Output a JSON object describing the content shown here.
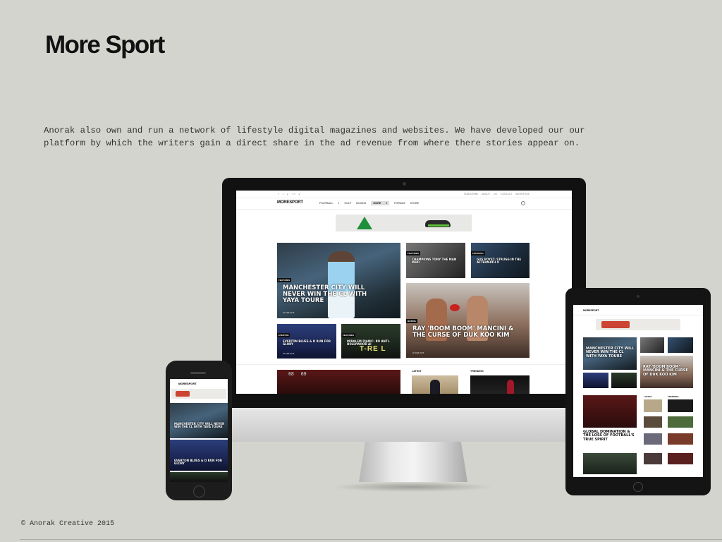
{
  "page": {
    "title": "More Sport",
    "intro": "Anorak also own and run a network of lifestyle digital magazines and websites. We have developed our our platform by which the writers gain a direct share in the ad revenue from where there stories appear on.",
    "footer": "© Anorak Creative 2015"
  },
  "site": {
    "logo": "MORESPORT",
    "social": "f t p in y",
    "top_links": "SUBSCRIBE ABOUT US CONTACT ADVERTISE",
    "nav": [
      "FOOTBALL ▾",
      "GOLF",
      "BOXING",
      "MORE ▾",
      "FORUMS",
      "STORE"
    ],
    "sections": {
      "latest": "LATEST",
      "trending": "TRENDING"
    },
    "articles": {
      "hero": {
        "tag": "FEATURES",
        "headline": "MANCHESTER CITY WILL NEVER WIN THE CL WITH YAYA TOURE",
        "date": "20 FEB 2015"
      },
      "t1": {
        "tag": "FEATURES",
        "headline": "CHAMPIONS TONY THE MAN WHO"
      },
      "t2": {
        "tag": "FOOTBALL",
        "headline": "GUS POYET: STRUGG IN THE AFTERMATH O"
      },
      "boxing": {
        "tag": "BOXING",
        "headline": "RAY 'BOOM BOOM' MANCINI & THE CURSE OF DUK KOO KIM",
        "date": "20 FEB 2015"
      },
      "everton": {
        "tag": "EVERTON",
        "headline": "EVERTON BLUES & D RUN FOR GLORY",
        "date": "20 FEB 2015"
      },
      "pjanic": {
        "tag": "FEATURES",
        "headline": "MIRALEM PJANIC: RO ANTI-HOLLYWOOD AI",
        "sign": "T-RE L"
      },
      "scoreboard": "68  69"
    }
  },
  "tablet": {
    "headlines": {
      "city": "MANCHESTER CITY WILL NEVER WIN THE CL WITH YAYA TOURE",
      "boxing": "RAY 'BOOM BOOM' MANCINI & THE CURSE OF DUK KOO KIM",
      "global": "GLOBAL DOMINATION & THE LOSS OF FOOTBALL'S TRUE SPIRIT"
    }
  },
  "phone": {
    "headlines": {
      "city": "MANCHESTER CITY WILL NEVER WIN THE CL WITH YAYA TOURE",
      "everton": "EVERTON BLUES & D RUN FOR GLORY"
    }
  }
}
